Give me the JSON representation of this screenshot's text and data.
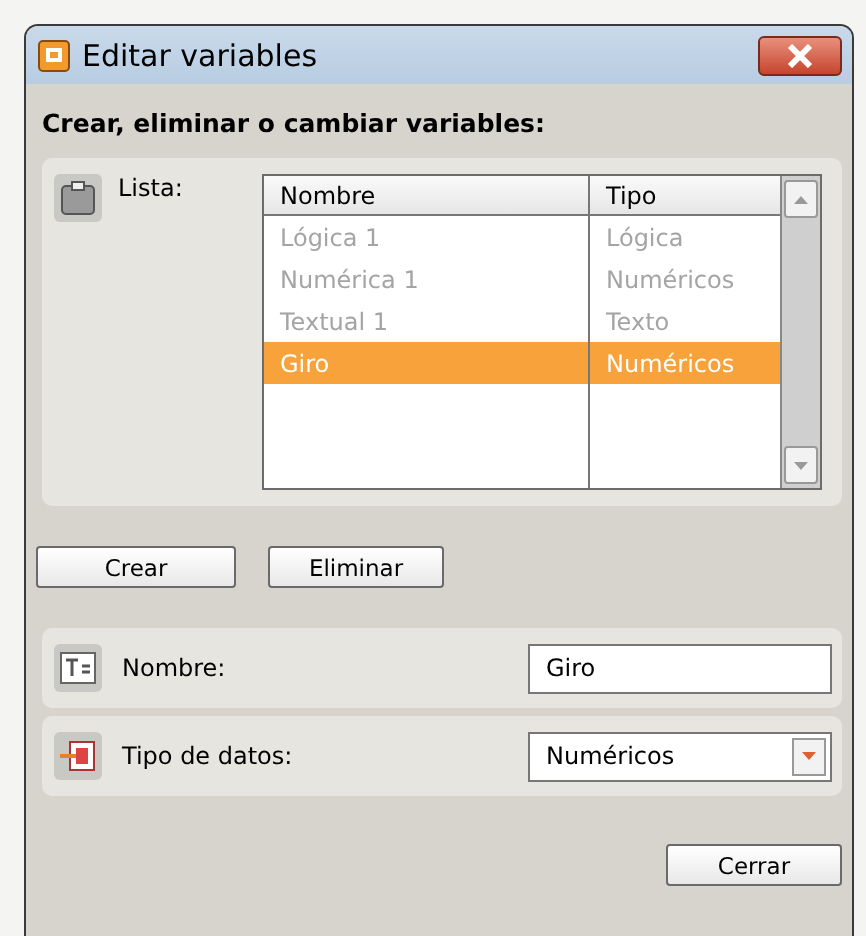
{
  "window": {
    "title": "Editar variables"
  },
  "heading": "Crear, eliminar o cambiar variables:",
  "list": {
    "label": "Lista:",
    "columns": [
      "Nombre",
      "Tipo"
    ],
    "rows": [
      {
        "name": "Lógica 1",
        "type": "Lógica",
        "selected": false
      },
      {
        "name": "Numérica 1",
        "type": "Numéricos",
        "selected": false
      },
      {
        "name": "Textual 1",
        "type": "Texto",
        "selected": false
      },
      {
        "name": "Giro",
        "type": "Numéricos",
        "selected": true
      }
    ]
  },
  "buttons": [
    "Crear",
    "Eliminar"
  ],
  "name_field": {
    "label": "Nombre:",
    "value": "Giro"
  },
  "type_field": {
    "label": "Tipo de datos:",
    "value": "Numéricos"
  },
  "close_button": "Cerrar"
}
